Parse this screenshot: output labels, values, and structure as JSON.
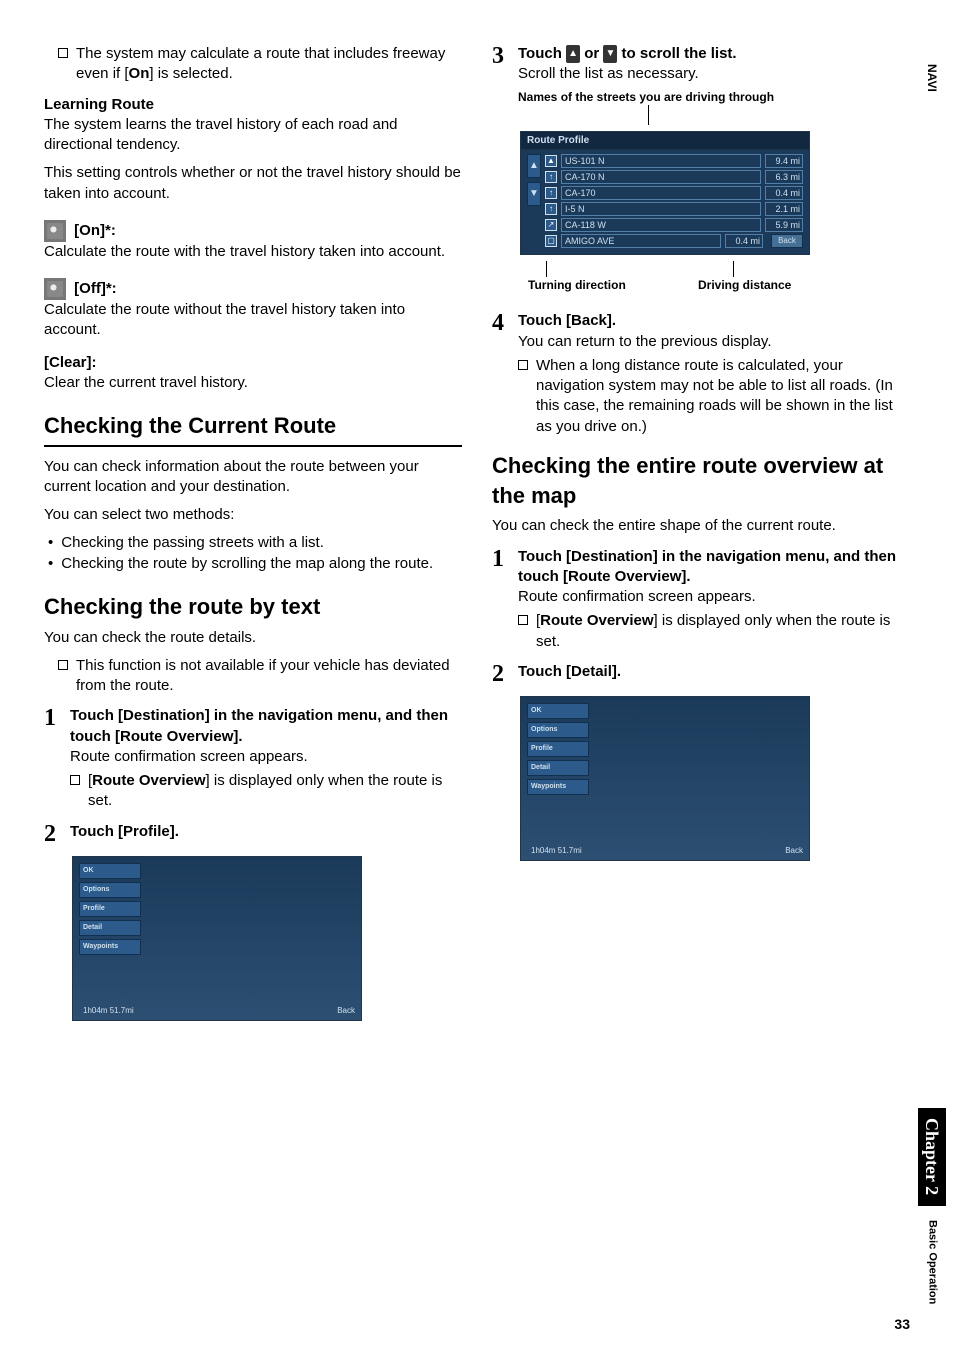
{
  "tabs": {
    "top": "NAVI",
    "chapter": "Chapter 2",
    "operation": "Basic Operation"
  },
  "page_number": "33",
  "left": {
    "note1": "The system may calculate a route that includes freeway even if [",
    "note1_bold": "On",
    "note1_end": "] is selected.",
    "learning_title": "Learning Route",
    "learning_p1": "The system learns the travel history of each road and directional tendency.",
    "learning_p2": "This setting controls whether or not the travel history should be taken into account.",
    "on_label": "[On]*:",
    "on_text": "Calculate the route with the travel history taken into account.",
    "off_label": "[Off]*:",
    "off_text": "Calculate the route without the travel history taken into account.",
    "clear_label": "[Clear]:",
    "clear_text": "Clear the current travel history.",
    "h2_current": "Checking the Current Route",
    "current_p1": "You can check information about the route between your current location and your destination.",
    "current_p2": "You can select two methods:",
    "bullet1": "Checking the passing streets with a list.",
    "bullet2": "Checking the route by scrolling the map along the route.",
    "h2_text": "Checking the route by text",
    "text_p1": "You can check the route details.",
    "text_note": "This function is not available if your vehicle has deviated from the route.",
    "step1_title": "Touch [Destination] in the navigation menu, and then touch [Route Overview].",
    "step1_body": "Route confirmation screen appears.",
    "step1_note_a": "[",
    "step1_note_bold": "Route Overview",
    "step1_note_b": "] is displayed only when the route is set.",
    "step2_title": "Touch [Profile].",
    "img_buttons": [
      "OK",
      "Options",
      "Profile",
      "Detail",
      "Waypoints"
    ],
    "img_status": "1h04m   51.7mi",
    "img_back": "Back"
  },
  "right": {
    "step3_title_a": "Touch ",
    "step3_title_b": " or ",
    "step3_title_c": " to scroll the list.",
    "step3_body": "Scroll the list as necessary.",
    "anno_top": "Names of the streets you are driving through",
    "route_header": "Route Profile",
    "route_rows": [
      {
        "turn": "▲",
        "name": "US-101 N",
        "dist": "9.4 mi"
      },
      {
        "turn": "↑",
        "name": "CA-170 N",
        "dist": "6.3 mi"
      },
      {
        "turn": "↑",
        "name": "CA-170",
        "dist": "0.4 mi"
      },
      {
        "turn": "↑",
        "name": "I-5 N",
        "dist": "2.1 mi"
      },
      {
        "turn": "↗",
        "name": "CA-118 W",
        "dist": "5.9 mi"
      },
      {
        "turn": "▢",
        "name": "AMIGO AVE",
        "dist": "0.4 mi"
      }
    ],
    "route_back": "Back",
    "anno_turn": "Turning direction",
    "anno_dist": "Driving distance",
    "step4_title": "Touch [Back].",
    "step4_body": "You can return to the previous display.",
    "step4_note": "When a long distance route is calculated, your navigation system may not be able to list all roads. (In this case, the remaining roads will be shown in the list as you drive on.)",
    "h2_map": "Checking the entire route overview at the map",
    "map_p1": "You can check the entire shape of the current route.",
    "r_step1_title": "Touch [Destination] in the navigation menu, and then touch [Route Overview].",
    "r_step1_body": "Route confirmation screen appears.",
    "r_step1_note_a": "[",
    "r_step1_note_bold": "Route Overview",
    "r_step1_note_b": "] is displayed only when the route is set.",
    "r_step2_title": "Touch [Detail].",
    "img_buttons": [
      "OK",
      "Options",
      "Profile",
      "Detail",
      "Waypoints"
    ],
    "img_status": "1h04m   51.7mi",
    "img_back": "Back"
  }
}
